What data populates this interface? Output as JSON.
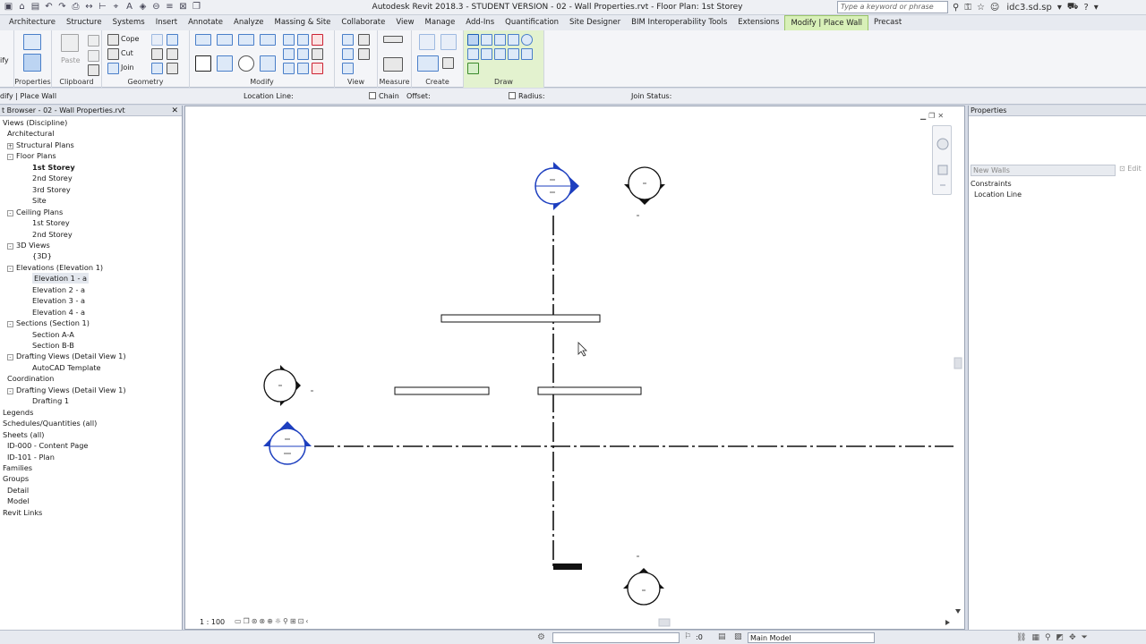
{
  "title": {
    "app_title": "Autodesk Revit 2018.3 - STUDENT VERSION -   02 - Wall Properties.rvt - Floor Plan: 1st Storey",
    "search_placeholder": "Type a keyword or phrase",
    "user": "idc3.sd.sp"
  },
  "tabs": [
    "Architecture",
    "Structure",
    "Systems",
    "Insert",
    "Annotate",
    "Analyze",
    "Massing & Site",
    "Collaborate",
    "View",
    "Manage",
    "Add-Ins",
    "Quantification",
    "Site Designer",
    "BIM Interoperability Tools",
    "Extensions",
    "Modify | Place Wall",
    "Precast"
  ],
  "active_tab": "Modify | Place Wall",
  "ribbon": {
    "modify_label": "ify",
    "properties_label": "Properties",
    "clipboard_label": "Clipboard",
    "paste_label": "Paste",
    "cope_label": "Cope",
    "cut_label": "Cut",
    "join_label": "Join",
    "geometry_label": "Geometry",
    "modify_panel_label": "Modify",
    "view_label": "View",
    "measure_label": "Measure",
    "create_label": "Create",
    "draw_label": "Draw"
  },
  "options_bar": {
    "context": "dify | Place Wall",
    "location_line": "Location Line:",
    "chain": "Chain",
    "offset": "Offset:",
    "radius": "Radius:",
    "join_status": "Join Status:"
  },
  "browser": {
    "title": "t Browser - 02 - Wall Properties.rvt",
    "items": [
      {
        "label": "Views (Discipline)",
        "indent": 0,
        "toggle": ""
      },
      {
        "label": "Architectural",
        "indent": 1,
        "toggle": ""
      },
      {
        "label": "Structural Plans",
        "indent": 2,
        "toggle": "+"
      },
      {
        "label": "Floor Plans",
        "indent": 2,
        "toggle": "-"
      },
      {
        "label": "1st Storey",
        "indent": 3,
        "toggle": "",
        "bold": true
      },
      {
        "label": "2nd Storey",
        "indent": 3,
        "toggle": ""
      },
      {
        "label": "3rd Storey",
        "indent": 3,
        "toggle": ""
      },
      {
        "label": "Site",
        "indent": 3,
        "toggle": ""
      },
      {
        "label": "Ceiling Plans",
        "indent": 2,
        "toggle": "-"
      },
      {
        "label": "1st Storey",
        "indent": 3,
        "toggle": ""
      },
      {
        "label": "2nd Storey",
        "indent": 3,
        "toggle": ""
      },
      {
        "label": "3D Views",
        "indent": 2,
        "toggle": "-"
      },
      {
        "label": "{3D}",
        "indent": 3,
        "toggle": ""
      },
      {
        "label": "Elevations (Elevation 1)",
        "indent": 2,
        "toggle": "-"
      },
      {
        "label": "Elevation 1 - a",
        "indent": 3,
        "toggle": "",
        "selected": true
      },
      {
        "label": "Elevation 2 - a",
        "indent": 3,
        "toggle": ""
      },
      {
        "label": "Elevation 3 - a",
        "indent": 3,
        "toggle": ""
      },
      {
        "label": "Elevation 4 - a",
        "indent": 3,
        "toggle": ""
      },
      {
        "label": "Sections (Section 1)",
        "indent": 2,
        "toggle": "-"
      },
      {
        "label": "Section A-A",
        "indent": 3,
        "toggle": ""
      },
      {
        "label": "Section B-B",
        "indent": 3,
        "toggle": ""
      },
      {
        "label": "Drafting Views (Detail View 1)",
        "indent": 2,
        "toggle": "-"
      },
      {
        "label": "AutoCAD Template",
        "indent": 3,
        "toggle": ""
      },
      {
        "label": "Coordination",
        "indent": 1,
        "toggle": ""
      },
      {
        "label": "Drafting Views (Detail View 1)",
        "indent": 2,
        "toggle": "-"
      },
      {
        "label": "Drafting 1",
        "indent": 3,
        "toggle": ""
      },
      {
        "label": "Legends",
        "indent": 0,
        "toggle": ""
      },
      {
        "label": "Schedules/Quantities (all)",
        "indent": 0,
        "toggle": ""
      },
      {
        "label": "Sheets (all)",
        "indent": 0,
        "toggle": ""
      },
      {
        "label": "ID-000 - Content Page",
        "indent": 1,
        "toggle": ""
      },
      {
        "label": "ID-101 - Plan",
        "indent": 1,
        "toggle": ""
      },
      {
        "label": "Families",
        "indent": 0,
        "toggle": ""
      },
      {
        "label": "Groups",
        "indent": 0,
        "toggle": ""
      },
      {
        "label": "Detail",
        "indent": 1,
        "toggle": ""
      },
      {
        "label": "Model",
        "indent": 1,
        "toggle": ""
      },
      {
        "label": "Revit Links",
        "indent": 0,
        "toggle": ""
      }
    ]
  },
  "canvas": {
    "scale": "1 : 100"
  },
  "properties": {
    "title": "Properties",
    "type": "New Walls",
    "edit_type": "Edit",
    "group": "Constraints",
    "row": "Location Line"
  },
  "status": {
    "number": ":0",
    "model": "Main Model"
  }
}
